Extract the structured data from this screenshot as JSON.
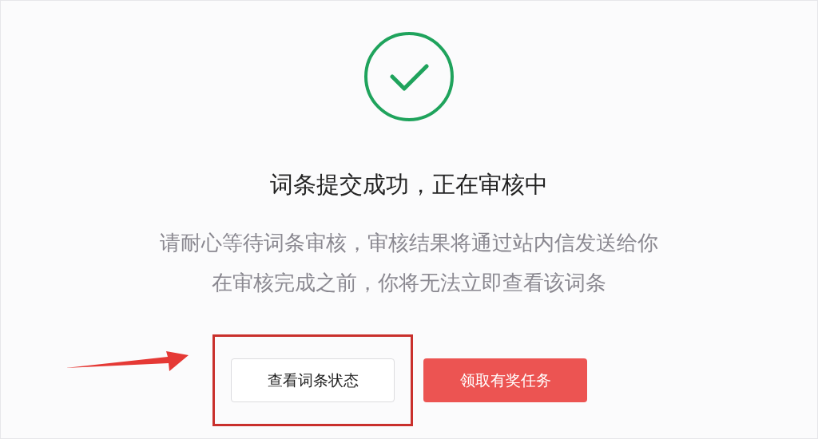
{
  "status": {
    "kind": "success"
  },
  "title": "词条提交成功，正在审核中",
  "message_lines": [
    "请耐心等待词条审核，审核结果将通过站内信发送给你",
    "在审核完成之前，你将无法立即查看该词条"
  ],
  "buttons": [
    {
      "label": "查看词条状态",
      "kind": "secondary",
      "highlighted": true
    },
    {
      "label": "领取有奖任务",
      "kind": "primary",
      "highlighted": false
    }
  ]
}
